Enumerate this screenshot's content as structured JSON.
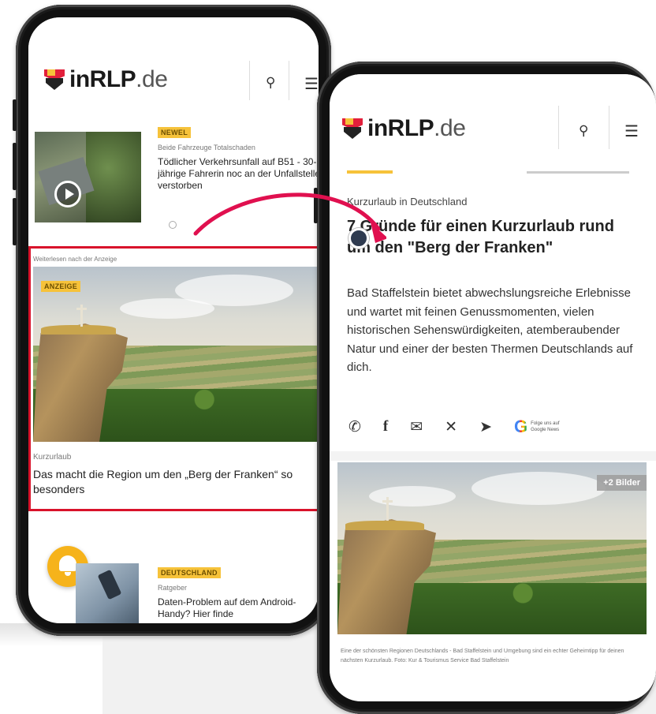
{
  "colors": {
    "accent_red": "#d9132b",
    "badge_yellow": "#f6c23a",
    "bell_orange": "#f6b31b",
    "arrow_pink": "#e0104f"
  },
  "brand": {
    "logo_bold": "inRLP",
    "logo_light": ".de"
  },
  "left_phone": {
    "feed_item_1": {
      "badge": "NEWEL",
      "kicker": "Beide Fahrzeuge Totalschaden",
      "title": "Tödlicher Verkehrsunfall auf B51 - 30-jährige Fahrerin noc an der Unfallstelle verstorben"
    },
    "ad_notice": "Weiterlesen nach der Anzeige",
    "ad": {
      "badge": "ANZEIGE",
      "kicker": "Kurzurlaub",
      "title": "Das macht die Region um den „Berg der Franken“ so besonders"
    },
    "feed_item_3": {
      "badge": "DEUTSCHLAND",
      "kicker": "Ratgeber",
      "title": "Daten-Problem auf dem Android-Handy? Hier finde"
    }
  },
  "right_phone": {
    "kicker": "Kurzurlaub in Deutschland",
    "title": "7 Gründe für einen Kurzurlaub rund um den \"Berg der Franken\"",
    "lead": "Bad Staffelstein bietet abwechslungsreiche Erlebnisse und wartet mit feinen Genussmomenten, vielen historischen Sehenswürdigkeiten, atemberaubender Natur und einer der besten Thermen Deutschlands auf dich.",
    "google_news": "Folge uns auf Google News",
    "more_pictures": "+2 Bilder",
    "caption": "Eine der schönsten Regionen Deutschlands - Bad Staffelstein und Umgebung sind ein echter Geheimtipp für deinen nächsten Kurzurlaub. Foto: Kur & Tourismus Service Bad Staffelstein"
  }
}
